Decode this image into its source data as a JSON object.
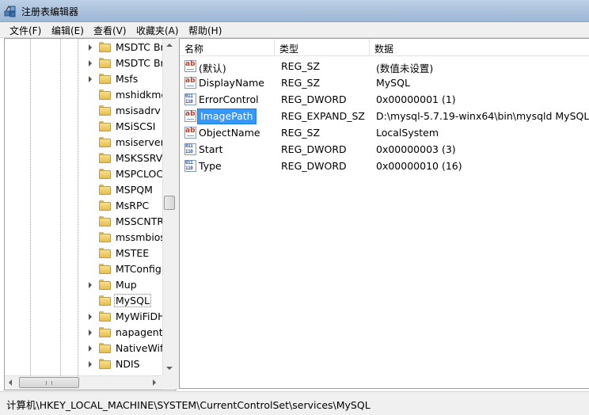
{
  "window": {
    "title": "注册表编辑器",
    "icon": "regedit-icon"
  },
  "menu": [
    {
      "label": "文件(F)"
    },
    {
      "label": "编辑(E)"
    },
    {
      "label": "查看(V)"
    },
    {
      "label": "收藏夹(A)"
    },
    {
      "label": "帮助(H)"
    }
  ],
  "tree": {
    "items": [
      {
        "label": "MSDTC Br",
        "expandable": true
      },
      {
        "label": "MSDTC Br",
        "expandable": true
      },
      {
        "label": "Msfs",
        "expandable": true
      },
      {
        "label": "mshidkmc",
        "expandable": false
      },
      {
        "label": "msisadrv",
        "expandable": false
      },
      {
        "label": "MSiSCSI",
        "expandable": false
      },
      {
        "label": "msiserver",
        "expandable": false
      },
      {
        "label": "MSKSSRV",
        "expandable": false
      },
      {
        "label": "MSPCLOC",
        "expandable": false
      },
      {
        "label": "MSPQM",
        "expandable": false
      },
      {
        "label": "MsRPC",
        "expandable": false
      },
      {
        "label": "MSSCNTR",
        "expandable": false
      },
      {
        "label": "mssmbios",
        "expandable": false
      },
      {
        "label": "MSTEE",
        "expandable": false
      },
      {
        "label": "MTConfig",
        "expandable": false
      },
      {
        "label": "Mup",
        "expandable": true
      },
      {
        "label": "MySQL",
        "expandable": false,
        "selected": true
      },
      {
        "label": "MyWiFiDH",
        "expandable": true
      },
      {
        "label": "napagent",
        "expandable": true
      },
      {
        "label": "NativeWif",
        "expandable": true
      },
      {
        "label": "NDIS",
        "expandable": true
      }
    ]
  },
  "values": {
    "columns": [
      "名称",
      "类型",
      "数据"
    ],
    "rows": [
      {
        "icon": "string-value-icon",
        "kind": "sz",
        "name": "(默认)",
        "type": "REG_SZ",
        "data": "(数值未设置)"
      },
      {
        "icon": "string-value-icon",
        "kind": "sz",
        "name": "DisplayName",
        "type": "REG_SZ",
        "data": "MySQL"
      },
      {
        "icon": "binary-value-icon",
        "kind": "dw",
        "name": "ErrorControl",
        "type": "REG_DWORD",
        "data": "0x00000001 (1)"
      },
      {
        "icon": "string-value-icon",
        "kind": "sz",
        "name": "ImagePath",
        "type": "REG_EXPAND_SZ",
        "data": "D:\\mysql-5.7.19-winx64\\bin\\mysqld MySQL",
        "selected": true
      },
      {
        "icon": "string-value-icon",
        "kind": "sz",
        "name": "ObjectName",
        "type": "REG_SZ",
        "data": "LocalSystem"
      },
      {
        "icon": "binary-value-icon",
        "kind": "dw",
        "name": "Start",
        "type": "REG_DWORD",
        "data": "0x00000003 (3)"
      },
      {
        "icon": "binary-value-icon",
        "kind": "dw",
        "name": "Type",
        "type": "REG_DWORD",
        "data": "0x00000010 (16)"
      }
    ]
  },
  "status": {
    "path": "计算机\\HKEY_LOCAL_MACHINE\\SYSTEM\\CurrentControlSet\\services\\MySQL"
  },
  "colors": {
    "selection": "#3399ff",
    "titlebar": "#aec4de",
    "folder": "#f0cd68"
  }
}
